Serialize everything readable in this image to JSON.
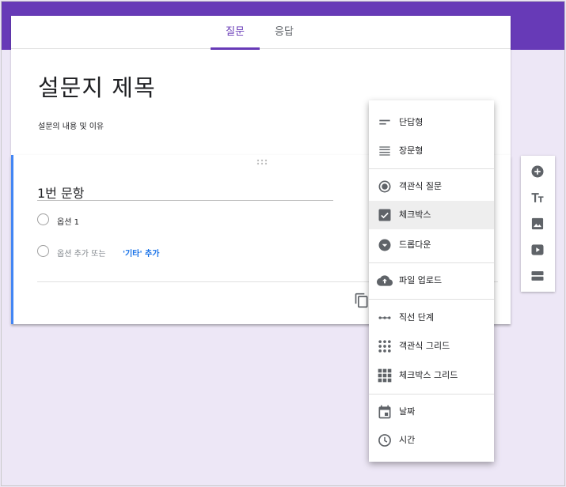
{
  "tabs": {
    "questions": "질문",
    "responses": "응답"
  },
  "form": {
    "title": "설문지 제목",
    "description": "설문의 내용 및 이유"
  },
  "question": {
    "title": "1번 문항",
    "option1": "옵션 1",
    "add_option": "옵션 추가 또는",
    "add_other": "'기타' 추가"
  },
  "menu": {
    "items": [
      {
        "label": "단답형",
        "icon": "short-text-icon"
      },
      {
        "label": "장문형",
        "icon": "paragraph-icon"
      },
      {
        "label": "객관식 질문",
        "icon": "radio-icon"
      },
      {
        "label": "체크박스",
        "icon": "checkbox-icon"
      },
      {
        "label": "드롭다운",
        "icon": "dropdown-icon"
      },
      {
        "label": "파일 업로드",
        "icon": "cloud-upload-icon"
      },
      {
        "label": "직선 단계",
        "icon": "linear-scale-icon"
      },
      {
        "label": "객관식 그리드",
        "icon": "dot-grid-icon"
      },
      {
        "label": "체크박스 그리드",
        "icon": "checkbox-grid-icon"
      },
      {
        "label": "날짜",
        "icon": "calendar-icon"
      },
      {
        "label": "시간",
        "icon": "clock-icon"
      }
    ],
    "selected": "체크박스"
  },
  "toolbar": {
    "icons": [
      "add-circle-icon",
      "title-text-icon",
      "image-icon",
      "video-icon",
      "section-icon"
    ]
  },
  "colors": {
    "accent": "#673ab7",
    "background": "#ede7f6",
    "link": "#1a73e8",
    "question_border": "#4285f4",
    "icon": "#5f6368"
  }
}
